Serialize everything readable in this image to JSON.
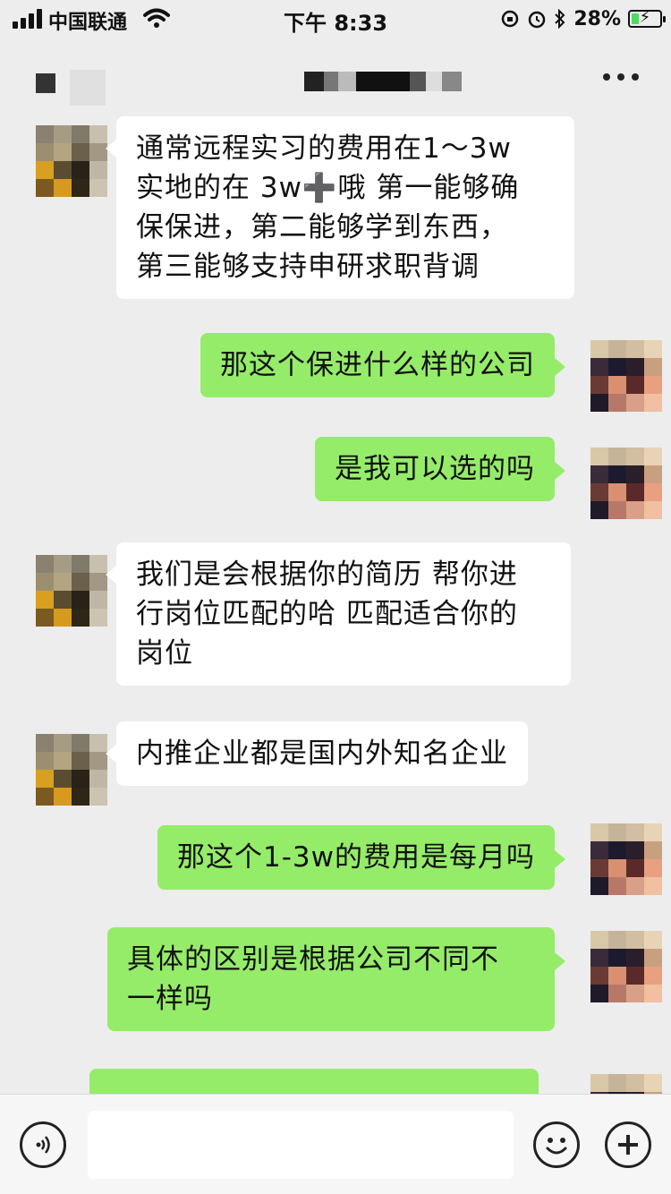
{
  "status_bar": {
    "carrier": "中国联通",
    "time": "下午 8:33",
    "battery": "28%",
    "battery_level": 0.28
  },
  "messages": [
    {
      "side": "in",
      "text": " 通常远程实习的费用在1～3w\n实地的在 3w➕哦  第一能够确\n保保进，第二能够学到东西，\n第三能够支持申研求职背调"
    },
    {
      "side": "out",
      "text": "那这个保进什么样的公司"
    },
    {
      "side": "out",
      "text": "是我可以选的吗"
    },
    {
      "side": "in",
      "text": "我们是会根据你的简历 帮你进\n行岗位匹配的哈 匹配适合你的\n岗位"
    },
    {
      "side": "in",
      "text": "内推企业都是国内外知名企业"
    },
    {
      "side": "out",
      "text": "那这个1-3w的费用是每月吗"
    },
    {
      "side": "out",
      "text": "具体的区别是根据公司不同不\n一样吗"
    }
  ],
  "colors": {
    "background": "#ededed",
    "incoming_bubble": "#ffffff",
    "outgoing_bubble": "#95ec69"
  }
}
